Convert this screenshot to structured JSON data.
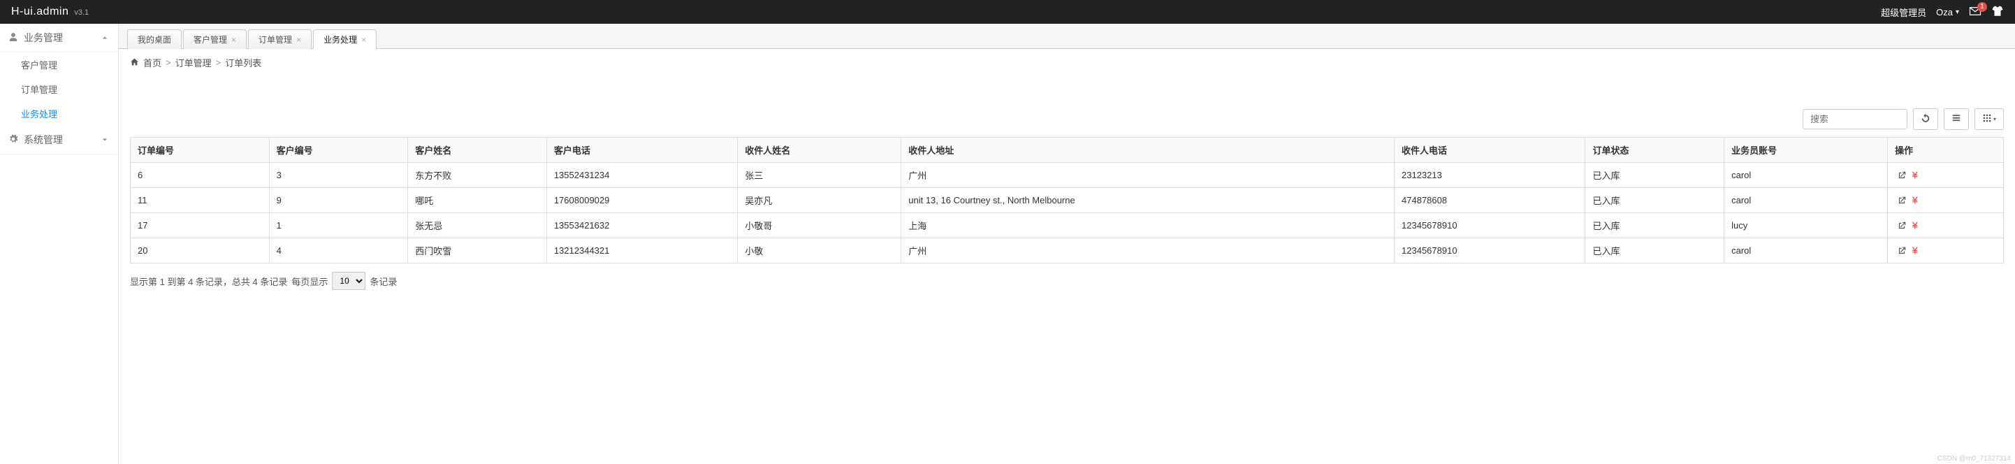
{
  "header": {
    "brand": "H-ui.admin",
    "version": "v3.1",
    "role_label": "超级管理员",
    "username": "Oza",
    "mail_badge": "1"
  },
  "sidebar": {
    "groups": [
      {
        "title": "业务管理",
        "expanded": true,
        "items": [
          {
            "label": "客户管理"
          },
          {
            "label": "订单管理"
          },
          {
            "label": "业务处理",
            "active": true
          }
        ]
      },
      {
        "title": "系统管理",
        "expanded": false,
        "items": []
      }
    ]
  },
  "tabs": [
    {
      "label": "我的桌面",
      "closable": false,
      "active": false
    },
    {
      "label": "客户管理",
      "closable": true,
      "active": false
    },
    {
      "label": "订单管理",
      "closable": true,
      "active": false
    },
    {
      "label": "业务处理",
      "closable": true,
      "active": true
    }
  ],
  "breadcrumb": {
    "home": "首页",
    "mid": "订单管理",
    "leaf": "订单列表"
  },
  "toolbar": {
    "search_placeholder": "搜索"
  },
  "table": {
    "columns": [
      "订单编号",
      "客户编号",
      "客户姓名",
      "客户电话",
      "收件人姓名",
      "收件人地址",
      "收件人电话",
      "订单状态",
      "业务员账号",
      "操作"
    ],
    "rows": [
      {
        "c": [
          "6",
          "3",
          "东方不败",
          "13552431234",
          "张三",
          "广州",
          "23123213",
          "已入库",
          "carol"
        ]
      },
      {
        "c": [
          "11",
          "9",
          "哪吒",
          "17608009029",
          "吴亦凡",
          "unit 13, 16 Courtney st., North Melbourne",
          "474878608",
          "已入库",
          "carol"
        ]
      },
      {
        "c": [
          "17",
          "1",
          "张无忌",
          "13553421632",
          "小敬哥",
          "上海",
          "12345678910",
          "已入库",
          "lucy"
        ]
      },
      {
        "c": [
          "20",
          "4",
          "西门吹雪",
          "13212344321",
          "小敬",
          "广州",
          "12345678910",
          "已入库",
          "carol"
        ]
      }
    ]
  },
  "footer": {
    "info_prefix": "显示第 1 到第 4 条记录，总共 4 条记录",
    "per_page_label_pre": "每页显示",
    "page_size": "10",
    "per_page_label_post": "条记录"
  },
  "watermark": "CSDN @m0_71327314"
}
